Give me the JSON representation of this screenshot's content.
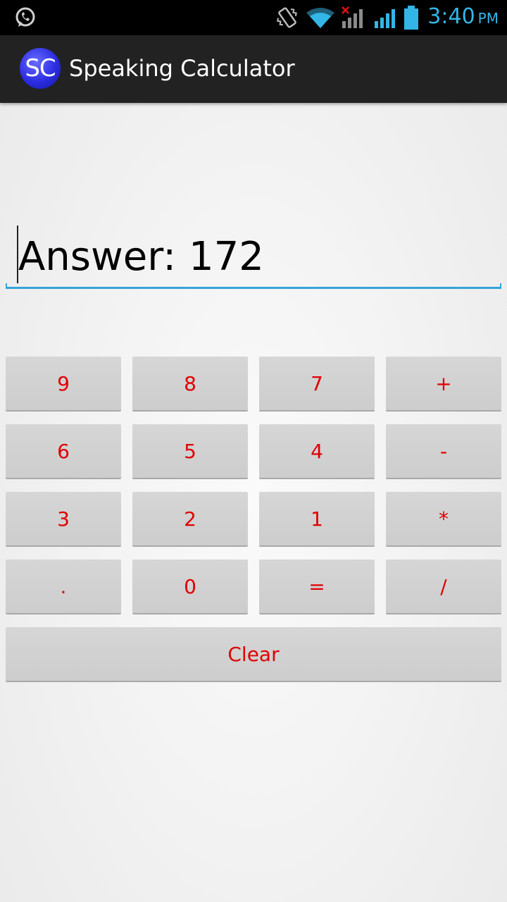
{
  "status_bar": {
    "time": "3:40",
    "ampm": "PM",
    "icons": [
      "whatsapp-icon",
      "vibrate-icon",
      "wifi-icon",
      "signal-no-service-icon",
      "signal-icon",
      "battery-icon"
    ],
    "accent_color": "#33b5e5"
  },
  "action_bar": {
    "logo_text": "SC",
    "title": "Speaking Calculator"
  },
  "display": {
    "value": "Answer: 172"
  },
  "keypad": {
    "key_color": "#e00000",
    "keys": [
      "9",
      "8",
      "7",
      "+",
      "6",
      "5",
      "4",
      "-",
      "3",
      "2",
      "1",
      "*",
      ".",
      "0",
      "=",
      "/"
    ],
    "clear": "Clear"
  }
}
